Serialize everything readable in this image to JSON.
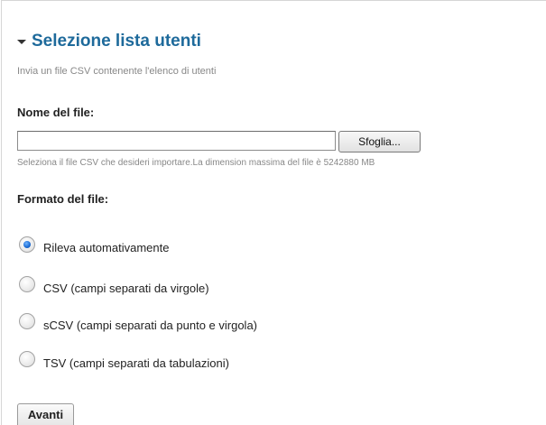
{
  "section": {
    "title": "Selezione lista utenti",
    "intro": "Invia un file CSV contenente l'elenco di utenti"
  },
  "file": {
    "label": "Nome del file:",
    "value": "",
    "browse_label": "Sfoglia...",
    "hint": "Seleziona il file CSV che desideri importare.La dimension massima del file è 5242880 MB"
  },
  "format": {
    "label": "Formato del file:",
    "options": [
      {
        "label": "Rileva automativamente",
        "checked": true
      },
      {
        "label": "CSV (campi separati da virgole)",
        "checked": false
      },
      {
        "label": "sCSV (campi separati da punto e virgola)",
        "checked": false
      },
      {
        "label": "TSV (campi separati da tabulazioni)",
        "checked": false
      }
    ]
  },
  "actions": {
    "next_label": "Avanti"
  },
  "colors": {
    "title": "#1e6a9b",
    "muted_text": "#888888",
    "radio_selected": "#1f6fd6"
  },
  "icons": {
    "collapse": "triangle-down-icon"
  }
}
